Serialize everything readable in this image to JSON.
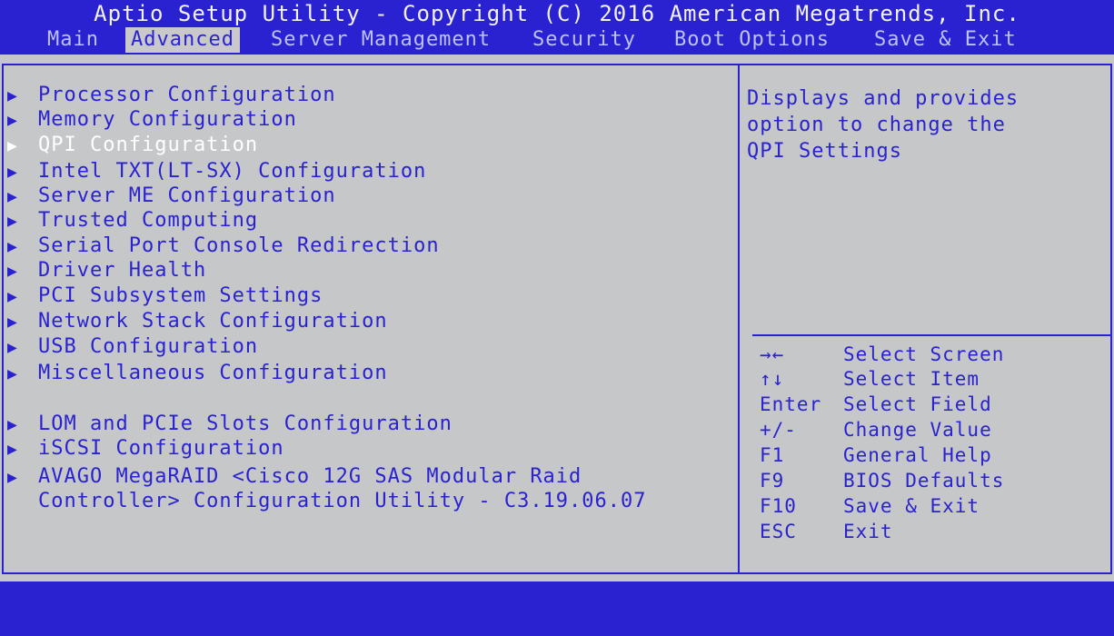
{
  "title": "Aptio Setup Utility - Copyright (C) 2016 American Megatrends, Inc.",
  "tabs": [
    {
      "label": "Main",
      "active": false
    },
    {
      "label": "Advanced",
      "active": true
    },
    {
      "label": "Server Management",
      "active": false
    },
    {
      "label": "Security",
      "active": false
    },
    {
      "label": "Boot Options",
      "active": false
    },
    {
      "label": "Save & Exit",
      "active": false
    }
  ],
  "menu": {
    "arrow": "▶",
    "items": [
      "Processor Configuration",
      "Memory Configuration",
      "QPI Configuration",
      "Intel TXT(LT-SX) Configuration",
      "Server ME Configuration",
      "Trusted Computing",
      "Serial Port Console Redirection",
      "Driver Health",
      "PCI Subsystem Settings",
      "Network Stack Configuration",
      "USB Configuration",
      "Miscellaneous Configuration",
      "LOM and PCIe Slots Configuration",
      "iSCSI Configuration",
      "AVAGO MegaRAID <Cisco 12G SAS Modular Raid",
      "Controller> Configuration Utility - C3.19.06.07"
    ],
    "selected_index": 2
  },
  "help": {
    "text": "Displays and provides\noption to change the\nQPI Settings"
  },
  "keys": [
    {
      "key": "→←",
      "desc": "Select Screen",
      "icon": "left-right-arrows-icon"
    },
    {
      "key": "↑↓",
      "desc": "Select Item",
      "icon": "up-down-arrows-icon"
    },
    {
      "key": "Enter",
      "desc": "Select Field"
    },
    {
      "key": "+/-",
      "desc": "Change Value"
    },
    {
      "key": "F1",
      "desc": "General Help"
    },
    {
      "key": "F9",
      "desc": "BIOS Defaults"
    },
    {
      "key": "F10",
      "desc": "Save & Exit"
    },
    {
      "key": "ESC",
      "desc": "Exit"
    }
  ],
  "colors": {
    "bios_blue": "#2a22d0",
    "panel_gray": "#c6c7c9",
    "highlight_white": "#ffffff"
  }
}
